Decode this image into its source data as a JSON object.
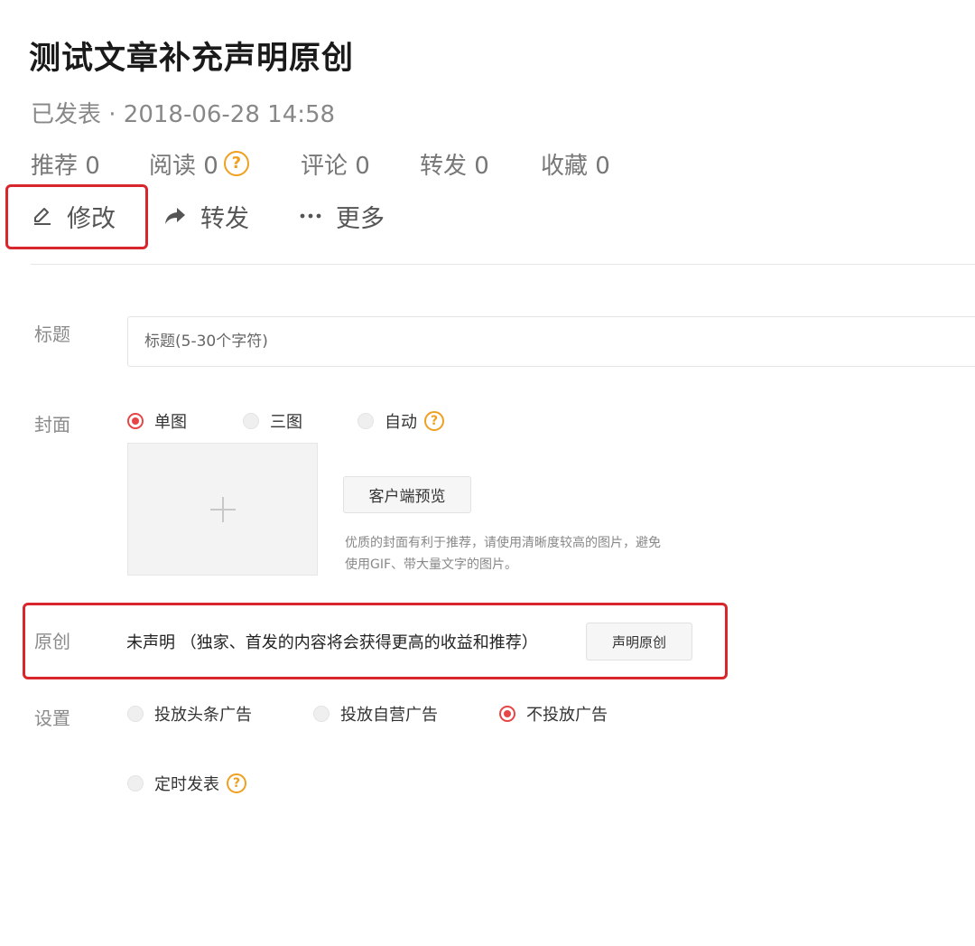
{
  "article": {
    "title": "测试文章补充声明原创",
    "meta": "已发表 · 2018-06-28 14:58",
    "stats": [
      {
        "label": "推荐 0"
      },
      {
        "label": "阅读 0"
      },
      {
        "label": "评论 0"
      },
      {
        "label": "转发 0"
      },
      {
        "label": "收藏 0"
      }
    ],
    "help_glyph": "?"
  },
  "actions": {
    "edit": "修改",
    "share": "转发",
    "more": "更多"
  },
  "form": {
    "title": {
      "label": "标题",
      "placeholder": "标题(5-30个字符)"
    },
    "cover": {
      "label": "封面",
      "options": [
        "单图",
        "三图",
        "自动"
      ],
      "selected": "单图",
      "preview_button": "客户端预览",
      "hint": "优质的封面有利于推荐，请使用清晰度较高的图片，避免使用GIF、带大量文字的图片。"
    },
    "original": {
      "label": "原创",
      "status": "未声明 （独家、首发的内容将会获得更高的收益和推荐）",
      "declare_button": "声明原创"
    },
    "settings": {
      "label": "设置",
      "ad_options": [
        "投放头条广告",
        "投放自营广告",
        "不投放广告"
      ],
      "ad_selected": "不投放广告",
      "schedule": "定时发表"
    }
  },
  "colors": {
    "accent_red": "#d9262c",
    "radio_red": "#e64646",
    "help_orange": "#f0a020"
  },
  "icons": {
    "edit": "pencil-icon",
    "share": "share-arrow-icon",
    "more": "ellipsis-icon",
    "help": "question-circle-icon",
    "add": "plus-icon"
  }
}
